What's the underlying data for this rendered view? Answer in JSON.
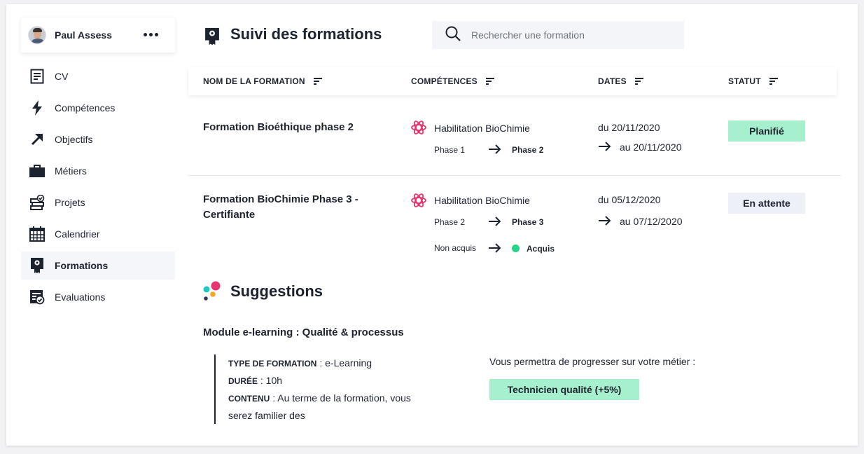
{
  "user": {
    "name": "Paul Assess"
  },
  "nav": {
    "items": [
      {
        "label": "CV",
        "icon": "document-icon"
      },
      {
        "label": "Compétences",
        "icon": "lightning-icon"
      },
      {
        "label": "Objectifs",
        "icon": "arrow-up-right-icon"
      },
      {
        "label": "Métiers",
        "icon": "briefcase-icon"
      },
      {
        "label": "Projets",
        "icon": "projects-icon"
      },
      {
        "label": "Calendrier",
        "icon": "calendar-icon"
      },
      {
        "label": "Formations",
        "icon": "certificate-icon",
        "active": true
      },
      {
        "label": "Evaluations",
        "icon": "evaluation-icon"
      }
    ]
  },
  "header": {
    "title": "Suivi des formations",
    "search_placeholder": "Rechercher une formation"
  },
  "table": {
    "columns": [
      "NOM DE LA FORMATION",
      "COMPÉTENCES",
      "DATES",
      "STATUT"
    ],
    "rows": [
      {
        "name": "Formation Bioéthique phase 2",
        "competence": "Habilitation BioChimie",
        "from_phase": "Phase 1",
        "to_phase": "Phase 2",
        "date_from": "du 20/11/2020",
        "date_to": "au 20/11/2020",
        "status": "Planifié",
        "status_color": "#a6f0cd"
      },
      {
        "name_line1": "Formation BioChimie Phase 3 -",
        "name_line2": "Certifiante",
        "competence": "Habilitation BioChimie",
        "from_phase": "Phase 2",
        "to_phase": "Phase 3",
        "from_state": "Non acquis",
        "to_state": "Acquis",
        "date_from": "du 05/12/2020",
        "date_to": "au 07/12/2020",
        "status": "En attente",
        "status_color": "#eef0f7"
      }
    ]
  },
  "suggestions": {
    "title": "Suggestions",
    "module": {
      "title": "Module e-learning : Qualité & processus",
      "type_key": "TYPE DE FORMATION",
      "type_value": " : e-Learning",
      "duration_key": "DURÉE",
      "duration_value": " : 10h",
      "content_key": "CONTENU",
      "content_value": " : Au terme de la formation, vous",
      "content_value_2": "serez familier des"
    },
    "progress_text": "Vous permettra de progresser sur votre métier :",
    "job_badge": "Technicien qualité (+5%)"
  },
  "colors": {
    "accent_pink": "#e8336e",
    "status_green": "#a6f0cd",
    "status_grey": "#eef0f7",
    "dot_green": "#25d58a"
  }
}
